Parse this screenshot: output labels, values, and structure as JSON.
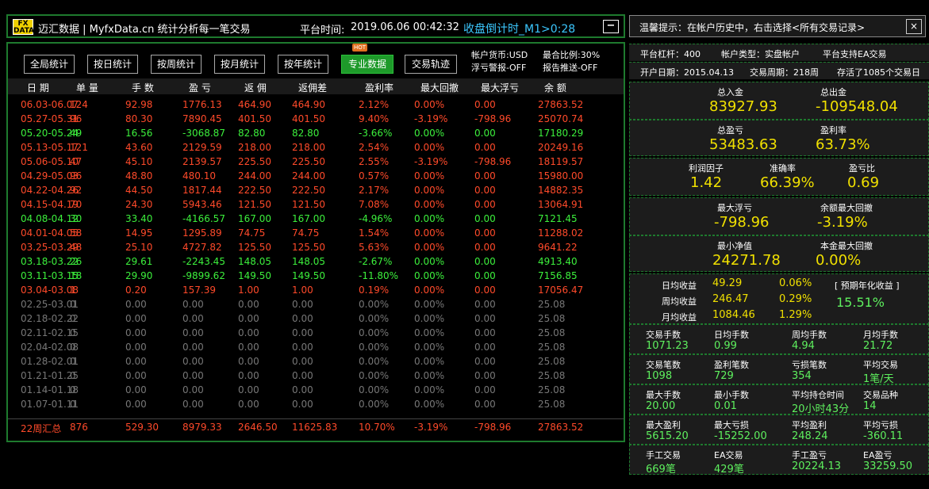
{
  "titlebar": {
    "logo_top": "FX",
    "logo_bottom": "DATA",
    "app_title": "迈汇数据 | MyfxData.cn  统计分析每一笔交易",
    "platform_time_label": "平台时间:",
    "platform_time": "2019.06.06 00:42:32",
    "countdown": "收盘倒计时_M1>0:28",
    "minimize": "−"
  },
  "tabs": [
    {
      "label": "全局统计"
    },
    {
      "label": "按日统计"
    },
    {
      "label": "按周统计"
    },
    {
      "label": "按月统计"
    },
    {
      "label": "按年统计"
    },
    {
      "label": "专业数据"
    },
    {
      "label": "交易轨迹"
    }
  ],
  "hot_badge": "HOT",
  "account_info": {
    "currency": "帐户货币:USD",
    "margin_ratio": "最合比例:30%",
    "float_loss_alert": "浮亏警报-OFF",
    "report_push": "报告推送-OFF"
  },
  "table": {
    "headers": [
      "日 期",
      "单 量",
      "手 数",
      "盈 亏",
      "返 佣",
      "返佣差",
      "盈利率",
      "最大回撤",
      "最大浮亏",
      "余 额"
    ],
    "rows": [
      {
        "cells": [
          "06.03-06.07",
          "124",
          "92.98",
          "1776.13",
          "464.90",
          "464.90",
          "2.12%",
          "0.00%",
          "0.00",
          "27863.52"
        ],
        "color": "red"
      },
      {
        "cells": [
          "05.27-05.31",
          "96",
          "80.30",
          "7890.45",
          "401.50",
          "401.50",
          "9.40%",
          "-3.19%",
          "-798.96",
          "25070.74"
        ],
        "color": "red"
      },
      {
        "cells": [
          "05.20-05.24",
          "49",
          "16.56",
          "-3068.87",
          "82.80",
          "82.80",
          "-3.66%",
          "0.00%",
          "0.00",
          "17180.29"
        ],
        "color": "green"
      },
      {
        "cells": [
          "05.13-05.17",
          "121",
          "43.60",
          "2129.59",
          "218.00",
          "218.00",
          "2.54%",
          "0.00%",
          "0.00",
          "20249.16"
        ],
        "color": "red"
      },
      {
        "cells": [
          "05.06-05.10",
          "47",
          "45.10",
          "2139.57",
          "225.50",
          "225.50",
          "2.55%",
          "-3.19%",
          "-798.96",
          "18119.57"
        ],
        "color": "red"
      },
      {
        "cells": [
          "04.29-05.03",
          "96",
          "48.80",
          "480.10",
          "244.00",
          "244.00",
          "0.57%",
          "0.00%",
          "0.00",
          "15980.00"
        ],
        "color": "red"
      },
      {
        "cells": [
          "04.22-04.26",
          "92",
          "44.50",
          "1817.44",
          "222.50",
          "222.50",
          "2.17%",
          "0.00%",
          "0.00",
          "14882.35"
        ],
        "color": "red"
      },
      {
        "cells": [
          "04.15-04.19",
          "70",
          "24.30",
          "5943.46",
          "121.50",
          "121.50",
          "7.08%",
          "0.00%",
          "0.00",
          "13064.91"
        ],
        "color": "red"
      },
      {
        "cells": [
          "04.08-04.12",
          "30",
          "33.40",
          "-4166.57",
          "167.00",
          "167.00",
          "-4.96%",
          "0.00%",
          "0.00",
          "7121.45"
        ],
        "color": "green"
      },
      {
        "cells": [
          "04.01-04.05",
          "58",
          "14.95",
          "1295.89",
          "74.75",
          "74.75",
          "1.54%",
          "0.00%",
          "0.00",
          "11288.02"
        ],
        "color": "red"
      },
      {
        "cells": [
          "03.25-03.29",
          "48",
          "25.10",
          "4727.82",
          "125.50",
          "125.50",
          "5.63%",
          "0.00%",
          "0.00",
          "9641.22"
        ],
        "color": "red"
      },
      {
        "cells": [
          "03.18-03.22",
          "26",
          "29.61",
          "-2243.45",
          "148.05",
          "148.05",
          "-2.67%",
          "0.00%",
          "0.00",
          "4913.40"
        ],
        "color": "green"
      },
      {
        "cells": [
          "03.11-03.15",
          "18",
          "29.90",
          "-9899.62",
          "149.50",
          "149.50",
          "-11.80%",
          "0.00%",
          "0.00",
          "7156.85"
        ],
        "color": "green"
      },
      {
        "cells": [
          "03.04-03.08",
          "1",
          "0.20",
          "157.39",
          "1.00",
          "1.00",
          "0.19%",
          "0.00%",
          "0.00",
          "17056.47"
        ],
        "color": "red"
      },
      {
        "cells": [
          "02.25-03.01",
          "0",
          "0.00",
          "0.00",
          "0.00",
          "0.00",
          "0.00%",
          "0.00%",
          "0.00",
          "25.08"
        ],
        "color": "gray"
      },
      {
        "cells": [
          "02.18-02.22",
          "0",
          "0.00",
          "0.00",
          "0.00",
          "0.00",
          "0.00%",
          "0.00%",
          "0.00",
          "25.08"
        ],
        "color": "gray"
      },
      {
        "cells": [
          "02.11-02.15",
          "0",
          "0.00",
          "0.00",
          "0.00",
          "0.00",
          "0.00%",
          "0.00%",
          "0.00",
          "25.08"
        ],
        "color": "gray"
      },
      {
        "cells": [
          "02.04-02.08",
          "0",
          "0.00",
          "0.00",
          "0.00",
          "0.00",
          "0.00%",
          "0.00%",
          "0.00",
          "25.08"
        ],
        "color": "gray"
      },
      {
        "cells": [
          "01.28-02.01",
          "0",
          "0.00",
          "0.00",
          "0.00",
          "0.00",
          "0.00%",
          "0.00%",
          "0.00",
          "25.08"
        ],
        "color": "gray"
      },
      {
        "cells": [
          "01.21-01.25",
          "0",
          "0.00",
          "0.00",
          "0.00",
          "0.00",
          "0.00%",
          "0.00%",
          "0.00",
          "25.08"
        ],
        "color": "gray"
      },
      {
        "cells": [
          "01.14-01.18",
          "0",
          "0.00",
          "0.00",
          "0.00",
          "0.00",
          "0.00%",
          "0.00%",
          "0.00",
          "25.08"
        ],
        "color": "gray"
      },
      {
        "cells": [
          "01.07-01.11",
          "0",
          "0.00",
          "0.00",
          "0.00",
          "0.00",
          "0.00%",
          "0.00%",
          "0.00",
          "25.08"
        ],
        "color": "gray"
      }
    ],
    "footer": [
      "22周汇总",
      "876",
      "529.30",
      "8979.33",
      "2646.50",
      "11625.83",
      "10.70%",
      "-3.19%",
      "-798.96",
      "27863.52"
    ]
  },
  "colors": {
    "red": "#ff4a2a",
    "green": "#3cf03c",
    "gray": "#777777",
    "accent_green": "#1e7a2e",
    "yellow": "#f0e000",
    "cyan": "#3cc8ff"
  },
  "right": {
    "notice": "温馨提示：在帐户历史中，右击选择<所有交易记录>",
    "close": "×",
    "leverage": "平台杠杆：400",
    "account_type": "帐户类型：实盘帐户",
    "ea_support": "平台支持EA交易",
    "open_date": "开户日期：2015.04.13",
    "trade_period": "交易周期：218周",
    "saved": "存活了1085个交易日",
    "deposit_label": "总入金",
    "deposit": "83927.93",
    "withdraw_label": "总出金",
    "withdraw": "-109548.04",
    "total_pl_label": "总盈亏",
    "total_pl": "53483.63",
    "profit_rate_label": "盈利率",
    "profit_rate": "63.73%",
    "profit_factor_label": "利润因子",
    "profit_factor": "1.42",
    "accuracy_label": "准确率",
    "accuracy": "66.39%",
    "pl_ratio_label": "盈亏比",
    "pl_ratio": "0.69",
    "max_float_label": "最大浮亏",
    "max_float": "-798.96",
    "max_dd_label": "余额最大回撤",
    "max_dd": "-3.19%",
    "min_equity_label": "最小净值",
    "min_equity": "24271.78",
    "principal_dd_label": "本金最大回撤",
    "principal_dd": "0.00%",
    "daily_label": "日均收益",
    "daily_val": "49.29",
    "daily_pct": "0.06%",
    "weekly_label": "周均收益",
    "weekly_val": "246.47",
    "weekly_pct": "0.29%",
    "monthly_label": "月均收益",
    "monthly_val": "1084.46",
    "monthly_pct": "1.29%",
    "annual_label": "[ 预期年化收益 ]",
    "annual": "15.51%",
    "grid": [
      [
        {
          "l": "交易手数",
          "v": "1071.23"
        },
        {
          "l": "日均手数",
          "v": "0.99"
        },
        {
          "l": "周均手数",
          "v": "4.94"
        },
        {
          "l": "月均手数",
          "v": "21.72"
        }
      ],
      [
        {
          "l": "交易笔数",
          "v": "1098"
        },
        {
          "l": "盈利笔数",
          "v": "729"
        },
        {
          "l": "亏损笔数",
          "v": "354"
        },
        {
          "l": "平均交易",
          "v": "1笔/天"
        }
      ],
      [
        {
          "l": "最大手数",
          "v": "20.00"
        },
        {
          "l": "最小手数",
          "v": "0.01"
        },
        {
          "l": "平均持仓时间",
          "v": "20小时43分"
        },
        {
          "l": "交易品种",
          "v": "14"
        }
      ],
      [
        {
          "l": "最大盈利",
          "v": "5615.20"
        },
        {
          "l": "最大亏损",
          "v": "-15252.00"
        },
        {
          "l": "平均盈利",
          "v": "248.24"
        },
        {
          "l": "平均亏损",
          "v": "-360.11"
        }
      ],
      [
        {
          "l": "手工交易",
          "v": "669笔"
        },
        {
          "l": "EA交易",
          "v": "429笔"
        },
        {
          "l": "手工盈亏",
          "v": "20224.13"
        },
        {
          "l": "EA盈亏",
          "v": "33259.50"
        }
      ]
    ]
  }
}
